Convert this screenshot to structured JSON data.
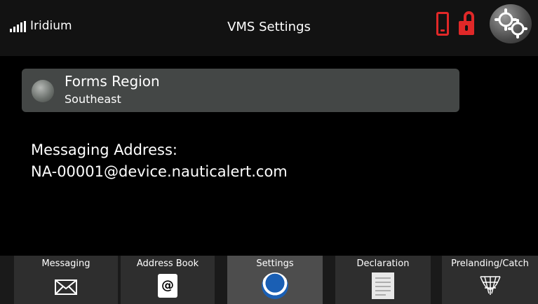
{
  "status_bar": {
    "carrier": "Iridium",
    "title": "VMS Settings",
    "icons": [
      "signal-icon",
      "phone-icon",
      "lock-icon",
      "gears-icon"
    ],
    "alert_color": "#e02828"
  },
  "forms_region": {
    "title": "Forms Region",
    "value": "Southeast"
  },
  "messaging": {
    "label": "Messaging Address:",
    "address": "NA-00001@device.nauticalert.com"
  },
  "nav": {
    "tabs": [
      {
        "label": "Messaging",
        "icon": "envelope-icon",
        "active": false
      },
      {
        "label": "Address Book",
        "icon": "address-book-icon",
        "active": false
      },
      {
        "label": "Settings",
        "icon": "noaa-logo-icon",
        "active": true
      },
      {
        "label": "Declaration",
        "icon": "document-icon",
        "active": false
      },
      {
        "label": "Prelanding/Catch",
        "icon": "fishing-net-icon",
        "active": false
      }
    ]
  }
}
